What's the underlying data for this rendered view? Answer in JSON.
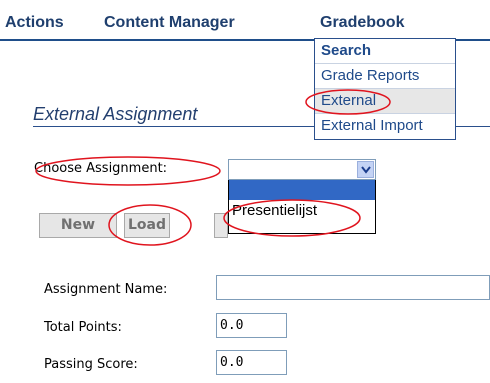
{
  "topnav": {
    "items": [
      {
        "label": "Actions"
      },
      {
        "label": "Content Manager"
      },
      {
        "label": "Gradebook"
      }
    ]
  },
  "gradebook_menu": {
    "items": [
      {
        "label": "Search"
      },
      {
        "label": "Grade Reports"
      },
      {
        "label": "External"
      },
      {
        "label": "External Import"
      }
    ]
  },
  "section": {
    "title": "External Assignment"
  },
  "choose": {
    "label": "Choose Assignment:",
    "selected_value": "",
    "options": [
      "",
      "Presentielijst"
    ]
  },
  "buttons": {
    "new_label": "New",
    "load_label": "Load"
  },
  "form": {
    "assignment_name_label": "Assignment Name:",
    "assignment_name_value": "",
    "total_points_label": "Total Points:",
    "total_points_value": "0.0",
    "passing_score_label": "Passing Score:",
    "passing_score_value": "0.0"
  },
  "colors": {
    "nav_text": "#1f3f6e",
    "menu_border": "#2a4f8c",
    "select_highlight": "#3168c5",
    "annotation_red": "#e0141e"
  }
}
